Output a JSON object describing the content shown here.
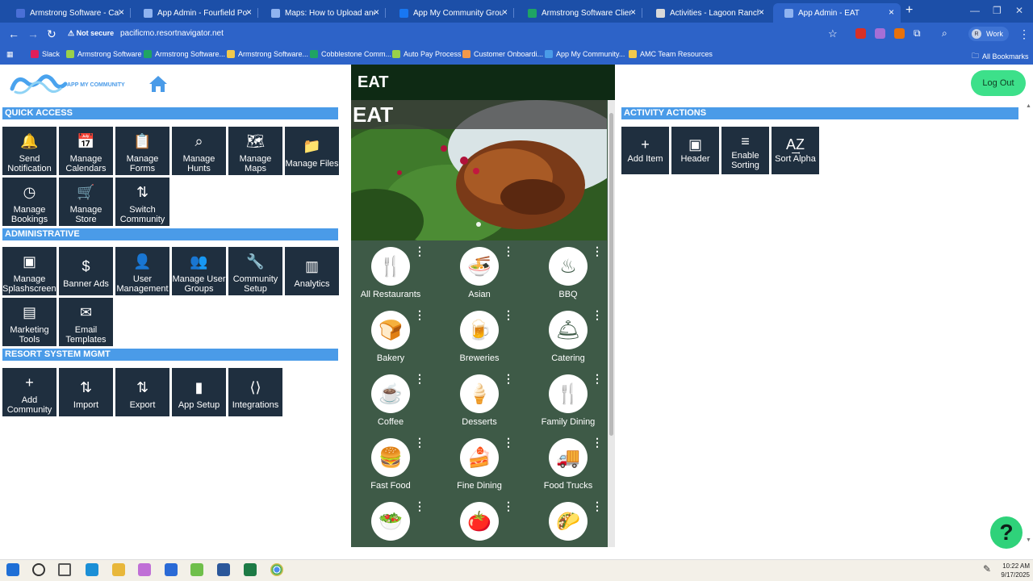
{
  "browser": {
    "tabs": [
      {
        "title": "Armstrong Software - Calendar",
        "color": "#4a6fd6"
      },
      {
        "title": "App Admin - Fourfield Pond RV",
        "color": "#8fb3f0"
      },
      {
        "title": "Maps: How to Upload and Ann",
        "color": "#8fb3f0"
      },
      {
        "title": "App My Community Group | Fa",
        "color": "#1877f2"
      },
      {
        "title": "Armstrong Software Client Stat",
        "color": "#1fa463"
      },
      {
        "title": "Activities - Lagoon Ranch Luxu",
        "color": "#d9d9d9"
      },
      {
        "title": "App Admin - EAT",
        "color": "#8fb3f0"
      }
    ],
    "new_tab": "+",
    "security_label": "Not secure",
    "url": "pacificmo.resortnavigator.net",
    "profile_label": "Work",
    "profile_initial": "R",
    "bookmarks": [
      {
        "label": "Slack",
        "color": "#e01e5a"
      },
      {
        "label": "Armstrong Software",
        "color": "#9ad04a"
      },
      {
        "label": "Armstrong Software...",
        "color": "#1fa463"
      },
      {
        "label": "Armstrong Software...",
        "color": "#f2c94c"
      },
      {
        "label": "Cobblestone Comm...",
        "color": "#1fa463"
      },
      {
        "label": "Auto Pay Process",
        "color": "#9ad04a"
      },
      {
        "label": "Customer Onboardi...",
        "color": "#f2994a"
      },
      {
        "label": "App My Community...",
        "color": "#4a9be8"
      },
      {
        "label": "AMC Team Resources",
        "color": "#f2c94c"
      }
    ],
    "all_bookmarks": "All Bookmarks"
  },
  "page": {
    "logo_text": "APP MY COMMUNITY",
    "logout": "Log Out",
    "help": "?",
    "sections": {
      "quick_access": {
        "title": "QUICK ACCESS",
        "tiles": [
          {
            "label": "Send Notification",
            "icon": "bell-icon",
            "glyph": "🔔"
          },
          {
            "label": "Manage Calendars",
            "icon": "calendar-icon",
            "glyph": "📅"
          },
          {
            "label": "Manage Forms",
            "icon": "clipboard-icon",
            "glyph": "📋"
          },
          {
            "label": "Manage Hunts",
            "icon": "search-icon",
            "glyph": "⌕"
          },
          {
            "label": "Manage Maps",
            "icon": "map-icon",
            "glyph": "🗺"
          },
          {
            "label": "Manage Files",
            "icon": "folder-icon",
            "glyph": "📁"
          },
          {
            "label": "Manage Bookings",
            "icon": "clock-icon",
            "glyph": "◷"
          },
          {
            "label": "Manage Store",
            "icon": "cart-icon",
            "glyph": "🛒"
          },
          {
            "label": "Switch Community",
            "icon": "switch-icon",
            "glyph": "⇅"
          }
        ]
      },
      "administrative": {
        "title": "ADMINISTRATIVE",
        "tiles": [
          {
            "label": "Manage Splashscreens",
            "icon": "image-icon",
            "glyph": "▣"
          },
          {
            "label": "Banner Ads",
            "icon": "dollar-icon",
            "glyph": "$"
          },
          {
            "label": "User Management",
            "icon": "user-icon",
            "glyph": "👤"
          },
          {
            "label": "Manage User Groups",
            "icon": "users-icon",
            "glyph": "👥"
          },
          {
            "label": "Community Setup",
            "icon": "wrench-icon",
            "glyph": "🔧"
          },
          {
            "label": "Analytics",
            "icon": "analytics-icon",
            "glyph": "▥"
          },
          {
            "label": "Marketing Tools",
            "icon": "marketing-icon",
            "glyph": "▤"
          },
          {
            "label": "Email Templates",
            "icon": "email-icon",
            "glyph": "✉"
          }
        ]
      },
      "resort": {
        "title": "RESORT SYSTEM MGMT",
        "tiles": [
          {
            "label": "Add Community",
            "icon": "plus-icon",
            "glyph": "+"
          },
          {
            "label": "Import",
            "icon": "import-icon",
            "glyph": "⇅"
          },
          {
            "label": "Export",
            "icon": "export-icon",
            "glyph": "⇅"
          },
          {
            "label": "App Setup",
            "icon": "app-setup-icon",
            "glyph": "▮"
          },
          {
            "label": "Integrations",
            "icon": "integrations-icon",
            "glyph": "⟨⟩"
          }
        ]
      }
    },
    "preview": {
      "header": "EAT",
      "hero_title": "EAT",
      "categories": [
        {
          "label": "All Restaurants",
          "icon": "utensils-icon",
          "glyph": "🍴"
        },
        {
          "label": "Asian",
          "icon": "noodles-icon",
          "glyph": "🍜"
        },
        {
          "label": "BBQ",
          "icon": "grill-icon",
          "glyph": "♨"
        },
        {
          "label": "Bakery",
          "icon": "bread-icon",
          "glyph": "🍞"
        },
        {
          "label": "Breweries",
          "icon": "beer-icon",
          "glyph": "🍺"
        },
        {
          "label": "Catering",
          "icon": "cloche-icon",
          "glyph": "🛎"
        },
        {
          "label": "Coffee",
          "icon": "coffee-icon",
          "glyph": "☕"
        },
        {
          "label": "Desserts",
          "icon": "icecream-icon",
          "glyph": "🍦"
        },
        {
          "label": "Family Dining",
          "icon": "utensils-icon",
          "glyph": "🍴"
        },
        {
          "label": "Fast Food",
          "icon": "fastfood-icon",
          "glyph": "🍔"
        },
        {
          "label": "Fine Dining",
          "icon": "cake-icon",
          "glyph": "🍰"
        },
        {
          "label": "Food Trucks",
          "icon": "truck-icon",
          "glyph": "🚚"
        },
        {
          "label": "",
          "icon": "salad-icon",
          "glyph": "🥗"
        },
        {
          "label": "",
          "icon": "tomato-icon",
          "glyph": "🍅"
        },
        {
          "label": "",
          "icon": "taco-icon",
          "glyph": "🌮"
        }
      ]
    },
    "actions": {
      "title": "ACTIVITY ACTIONS",
      "tiles": [
        {
          "label": "Add Item",
          "icon": "plus-icon",
          "glyph": "+"
        },
        {
          "label": "Header",
          "icon": "image-icon",
          "glyph": "▣"
        },
        {
          "label": "Enable Sorting",
          "icon": "sort-icon",
          "glyph": "≡"
        },
        {
          "label": "Sort Alpha",
          "icon": "sort-alpha-icon",
          "glyph": "A͢Z"
        }
      ]
    }
  },
  "taskbar": {
    "time": "10:22 AM",
    "date": "9/17/2025"
  }
}
